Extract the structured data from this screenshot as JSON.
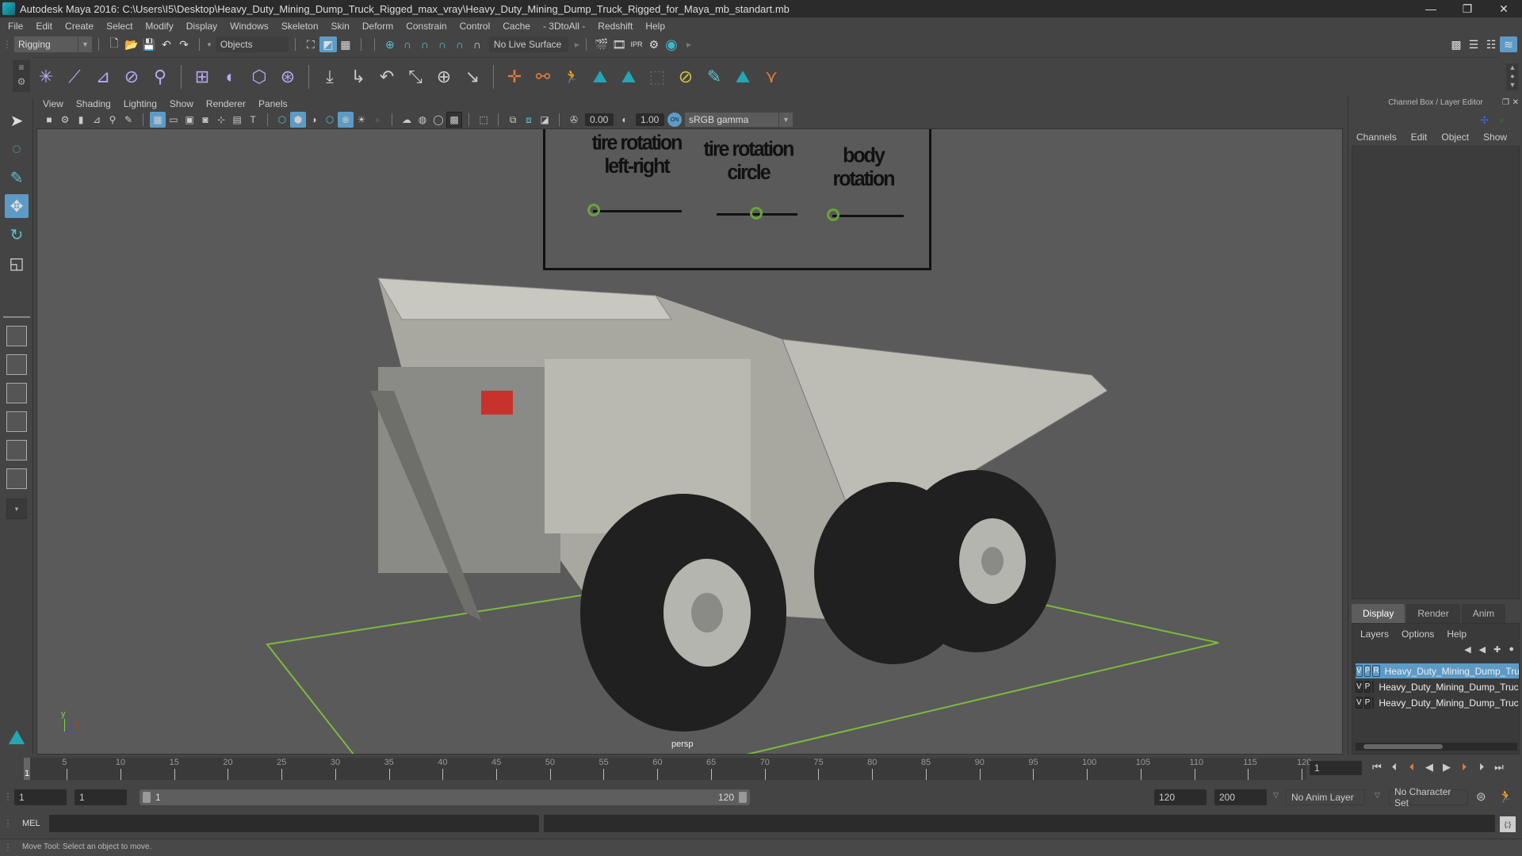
{
  "window": {
    "title": "Autodesk Maya 2016: C:\\Users\\I5\\Desktop\\Heavy_Duty_Mining_Dump_Truck_Rigged_max_vray\\Heavy_Duty_Mining_Dump_Truck_Rigged_for_Maya_mb_standart.mb",
    "minimize": "—",
    "restore": "❐",
    "close": "✕"
  },
  "menubar": [
    "File",
    "Edit",
    "Create",
    "Select",
    "Modify",
    "Display",
    "Windows",
    "Skeleton",
    "Skin",
    "Deform",
    "Constrain",
    "Control",
    "Cache",
    "- 3DtoAll -",
    "Redshift",
    "Help"
  ],
  "statusline": {
    "menuset": "Rigging",
    "selection_mode": "Objects",
    "live_surface": "No Live Surface"
  },
  "panel": {
    "menus": [
      "View",
      "Shading",
      "Lighting",
      "Show",
      "Renderer",
      "Panels"
    ],
    "exposure": "0.00",
    "gamma": "1.00",
    "color_mgmt_toggle": "ON",
    "color_space": "sRGB gamma",
    "camera_label": "persp"
  },
  "viewport": {
    "control_labels": [
      {
        "line1": "tire rotation",
        "line2": "left-right"
      },
      {
        "line1": "tire rotation",
        "line2": "circle"
      },
      {
        "line1": "body",
        "line2": "rotation"
      }
    ],
    "axis": {
      "y": "y",
      "z": "z",
      "x": "x"
    }
  },
  "channel_box": {
    "title": "Channel Box / Layer Editor",
    "menus": [
      "Channels",
      "Edit",
      "Object",
      "Show"
    ]
  },
  "layer_editor": {
    "tabs": [
      "Display",
      "Render",
      "Anim"
    ],
    "active_tab": "Display",
    "menus": [
      "Layers",
      "Options",
      "Help"
    ],
    "layers": [
      {
        "v": "V",
        "p": "P",
        "r": "R",
        "color": "#0e5a2a",
        "name": "Heavy_Duty_Mining_Dump_Truck_Rigged",
        "selected": true
      },
      {
        "v": "V",
        "p": "P",
        "r": "",
        "color": "#0a1a80",
        "name": "Heavy_Duty_Mining_Dump_Truck_Rigged",
        "selected": false
      },
      {
        "v": "V",
        "p": "P",
        "r": "",
        "color": "#6ab33a",
        "name": "Heavy_Duty_Mining_Dump_Truck_Rigged",
        "selected": false
      }
    ]
  },
  "timeline": {
    "ticks": [
      5,
      10,
      15,
      20,
      25,
      30,
      35,
      40,
      45,
      50,
      55,
      60,
      65,
      70,
      75,
      80,
      85,
      90,
      95,
      100,
      105,
      110,
      115,
      120
    ],
    "start": 1,
    "end": 120,
    "current_frame_marker": "1",
    "current_frame": "1"
  },
  "range": {
    "start_time": "1",
    "playback_start": "1",
    "slider_start": "1",
    "slider_end": "120",
    "playback_end": "120",
    "end_time": "200",
    "anim_layer": "No Anim Layer",
    "character_set": "No Character Set"
  },
  "commandline": {
    "language": "MEL",
    "input": "",
    "result": ""
  },
  "helpline": {
    "text": "Move Tool: Select an object to move."
  },
  "colors": {
    "accent": "#5d9bc6",
    "control_green": "#6aa33a",
    "key_orange": "#e07a3c"
  }
}
